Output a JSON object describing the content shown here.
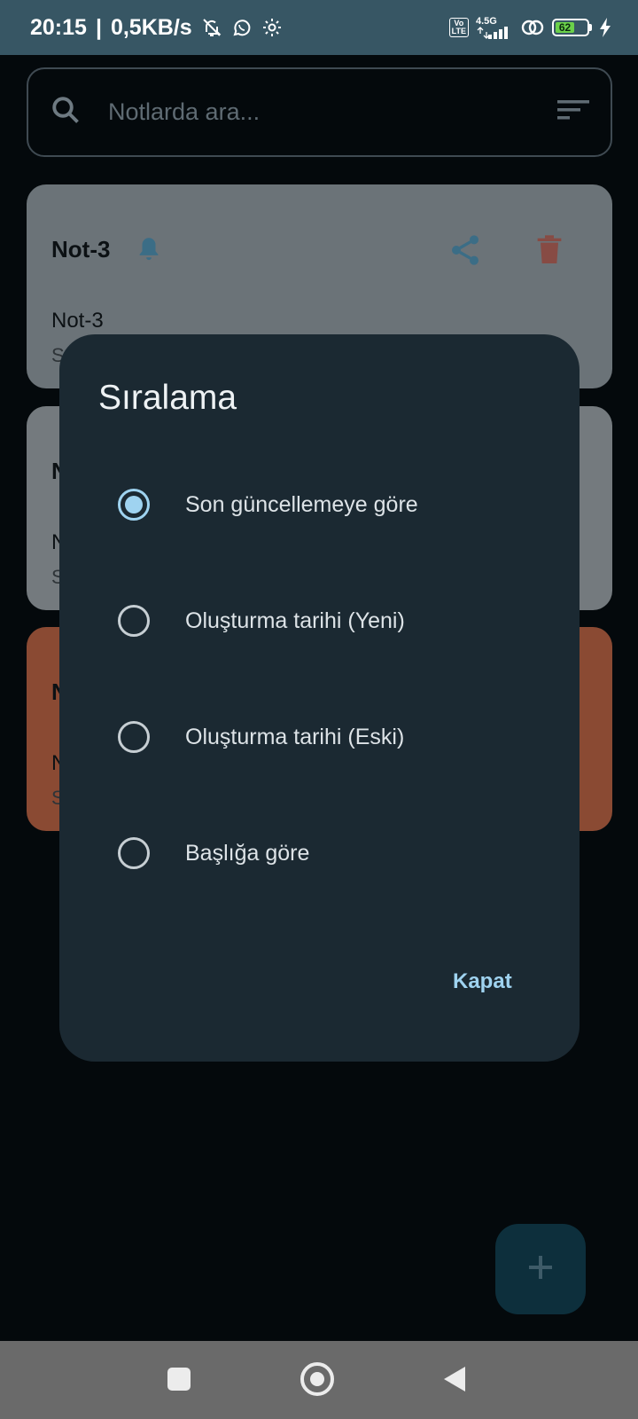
{
  "status_bar": {
    "time": "20:15",
    "separator": "|",
    "net_speed": "0,5KB/s",
    "volte_top": "Vo",
    "volte_bottom": "LTE",
    "network_type": "4.5G",
    "battery_level": "62",
    "icons": [
      "bell-off-icon",
      "whatsapp-icon",
      "gear-icon",
      "volte-icon",
      "signal-icon",
      "hotspot-icon",
      "battery-icon",
      "charging-icon"
    ]
  },
  "search": {
    "placeholder": "Notlarda ara...",
    "icons": [
      "search-icon",
      "sort-icon"
    ]
  },
  "notes": [
    {
      "title": "Not-3",
      "body": "Not-3",
      "sub": "S",
      "color": "#6b7378",
      "reminder": true
    },
    {
      "title": "N",
      "body": "N",
      "sub": "S",
      "color": "#747a7e",
      "reminder": false
    },
    {
      "title": "N",
      "body": "N",
      "sub": "S",
      "color": "#8a4a33",
      "reminder": false
    }
  ],
  "fab": {
    "icon": "plus-icon"
  },
  "dialog": {
    "title": "Sıralama",
    "options": [
      {
        "label": "Son güncellemeye göre",
        "selected": true
      },
      {
        "label": "Oluşturma tarihi (Yeni)",
        "selected": false
      },
      {
        "label": "Oluşturma tarihi (Eski)",
        "selected": false
      },
      {
        "label": "Başlığa göre",
        "selected": false
      }
    ],
    "close_label": "Kapat"
  },
  "nav": {
    "icons": [
      "recents-icon",
      "home-icon",
      "back-icon"
    ]
  },
  "colors": {
    "accent": "#9fd3f0",
    "dialog_bg": "#1b2932",
    "status_bar": "#375664"
  }
}
